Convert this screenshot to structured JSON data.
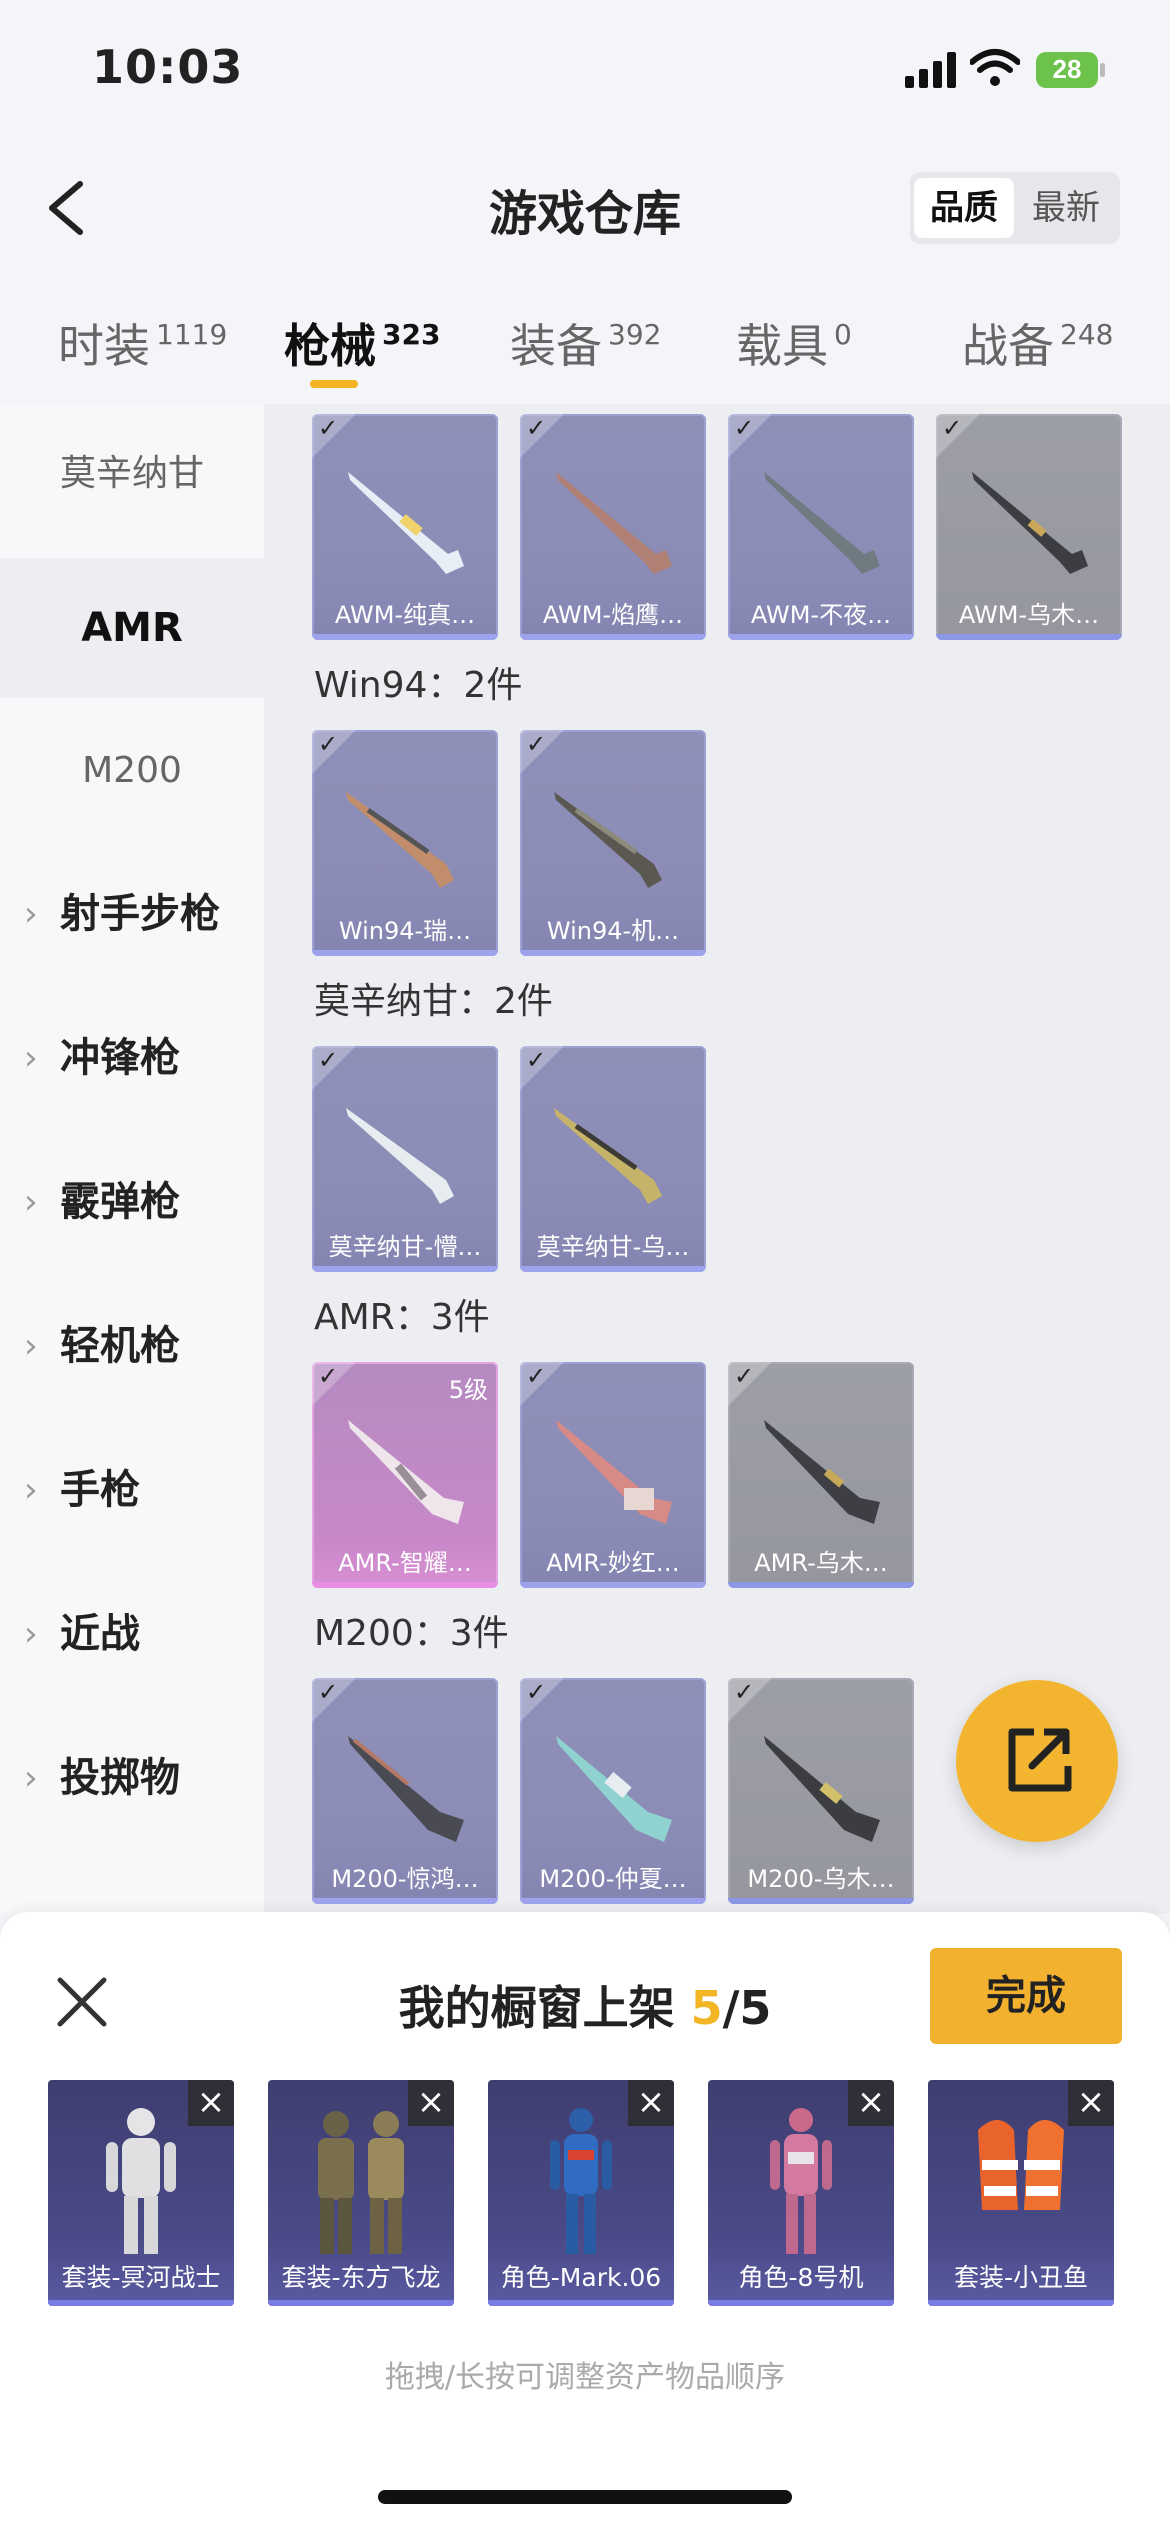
{
  "status": {
    "time": "10:03",
    "battery": "28"
  },
  "header": {
    "title": "游戏仓库",
    "sort_quality": "品质",
    "sort_newest": "最新"
  },
  "tabs": [
    {
      "label": "时装",
      "count": "1119"
    },
    {
      "label": "枪械",
      "count": "323"
    },
    {
      "label": "装备",
      "count": "392"
    },
    {
      "label": "载具",
      "count": "0"
    },
    {
      "label": "战备",
      "count": "248"
    }
  ],
  "side": {
    "sub_items": [
      "莫辛纳甘",
      "AMR",
      "M200"
    ],
    "categories": [
      "射手步枪",
      "冲锋枪",
      "霰弹枪",
      "轻机枪",
      "手枪",
      "近战",
      "投掷物"
    ]
  },
  "groups": [
    {
      "title": "",
      "items": [
        "AWM-纯真…",
        "AWM-焰鹰…",
        "AWM-不夜…",
        "AWM-乌木…"
      ]
    },
    {
      "title": "Win94：2件",
      "items": [
        "Win94-瑞…",
        "Win94-机…"
      ]
    },
    {
      "title": "莫辛纳甘：2件",
      "items": [
        "莫辛纳甘-懵…",
        "莫辛纳甘-乌…"
      ]
    },
    {
      "title": "AMR：3件",
      "items": [
        "AMR-智耀…",
        "AMR-妙红…",
        "AMR-乌木…"
      ],
      "level": "5级"
    },
    {
      "title": "M200：3件",
      "items": [
        "M200-惊鸿…",
        "M200-仲夏…",
        "M200-乌木…"
      ]
    }
  ],
  "sheet": {
    "title": "我的橱窗上架",
    "count": "5",
    "total": "/5",
    "done": "完成",
    "slots": [
      "套装-冥河战士",
      "套装-东方飞龙",
      "角色-Mark.06",
      "角色-8号机",
      "套装-小丑鱼"
    ],
    "hint": "拖拽/长按可调整资产物品顺序"
  },
  "colors": {
    "accent": "#f2b523",
    "purple_card": "#8f90b8",
    "gray_card": "#9d9ea6",
    "pink_card": "#c888c9"
  }
}
